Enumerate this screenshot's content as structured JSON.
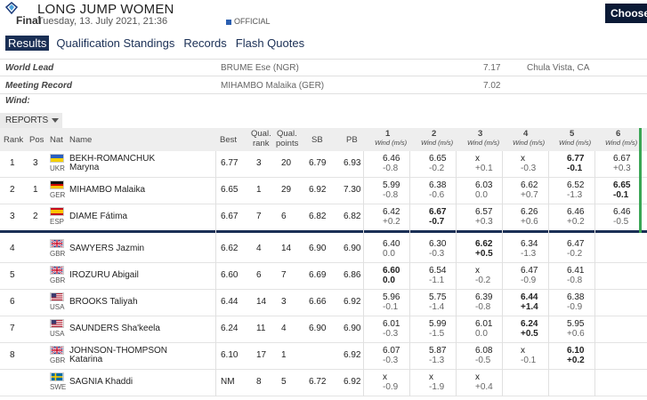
{
  "header": {
    "title": "LONG JUMP WOMEN",
    "phase": "Final",
    "datetime": "Tuesday, 13. July 2021, 21:36",
    "official": "OFFICIAL",
    "choose": "Choose"
  },
  "tabs": [
    "Results",
    "Qualification Standings",
    "Records",
    "Flash Quotes"
  ],
  "info": [
    {
      "label": "World Lead",
      "name": "BRUME Ese (NGR)",
      "value": "7.17",
      "place": "Chula Vista, CA"
    },
    {
      "label": "Meeting Record",
      "name": "MIHAMBO Malaika (GER)",
      "value": "7.02",
      "place": ""
    },
    {
      "label": "Wind:",
      "name": "",
      "value": "",
      "place": ""
    }
  ],
  "reports_label": "REPORTS",
  "columns": {
    "rank": "Rank",
    "pos": "Pos",
    "nat": "Nat",
    "name": "Name",
    "best": "Best",
    "qual_rank_1": "Qual.",
    "qual_rank_2": "rank",
    "qual_points_1": "Qual.",
    "qual_points_2": "points",
    "sb": "SB",
    "pb": "PB",
    "attempts": [
      "1",
      "2",
      "3",
      "4",
      "5",
      "6"
    ],
    "wind_label": "Wind (m/s)"
  },
  "rows": [
    {
      "rank": "1",
      "pos": "3",
      "nat": "UKR",
      "name1": "BEKH-ROMANCHUK",
      "name2": "Maryna",
      "best": "6.77",
      "qr": "3",
      "qp": "20",
      "sb": "6.79",
      "pb": "6.93",
      "att": [
        [
          "6.46",
          "-0.8"
        ],
        [
          "6.65",
          "-0.2"
        ],
        [
          "x",
          "+0.1"
        ],
        [
          "x",
          "-0.3"
        ],
        [
          "6.77",
          "-0.1"
        ],
        [
          "6.67",
          "+0.3"
        ]
      ],
      "bold": [
        4
      ]
    },
    {
      "rank": "2",
      "pos": "1",
      "nat": "GER",
      "name1": "MIHAMBO Malaika",
      "name2": "",
      "best": "6.65",
      "qr": "1",
      "qp": "29",
      "sb": "6.92",
      "pb": "7.30",
      "att": [
        [
          "5.99",
          "-0.8"
        ],
        [
          "6.38",
          "-0.6"
        ],
        [
          "6.03",
          "0.0"
        ],
        [
          "6.62",
          "+0.7"
        ],
        [
          "6.52",
          "-1.3"
        ],
        [
          "6.65",
          "-0.1"
        ]
      ],
      "bold": [
        5
      ]
    },
    {
      "rank": "3",
      "pos": "2",
      "nat": "ESP",
      "name1": "DIAME Fátima",
      "name2": "",
      "best": "6.67",
      "qr": "7",
      "qp": "6",
      "sb": "6.82",
      "pb": "6.82",
      "att": [
        [
          "6.42",
          "+0.2"
        ],
        [
          "6.67",
          "-0.7"
        ],
        [
          "6.57",
          "+0.3"
        ],
        [
          "6.26",
          "+0.6"
        ],
        [
          "6.46",
          "+0.2"
        ],
        [
          "6.46",
          "-0.5"
        ]
      ],
      "bold": [
        1
      ]
    },
    {
      "rank": "4",
      "pos": "",
      "nat": "GBR",
      "name1": "SAWYERS Jazmin",
      "name2": "",
      "best": "6.62",
      "qr": "4",
      "qp": "14",
      "sb": "6.90",
      "pb": "6.90",
      "att": [
        [
          "6.40",
          "0.0"
        ],
        [
          "6.30",
          "-0.3"
        ],
        [
          "6.62",
          "+0.5"
        ],
        [
          "6.34",
          "-1.3"
        ],
        [
          "6.47",
          "-0.2"
        ],
        [
          "",
          ""
        ]
      ],
      "bold": [
        2
      ]
    },
    {
      "rank": "5",
      "pos": "",
      "nat": "GBR",
      "name1": "IROZURU Abigail",
      "name2": "",
      "best": "6.60",
      "qr": "6",
      "qp": "7",
      "sb": "6.69",
      "pb": "6.86",
      "att": [
        [
          "6.60",
          "0.0"
        ],
        [
          "6.54",
          "-1.1"
        ],
        [
          "x",
          "-0.2"
        ],
        [
          "6.47",
          "-0.9"
        ],
        [
          "6.41",
          "-0.8"
        ],
        [
          "",
          ""
        ]
      ],
      "bold": [
        0
      ]
    },
    {
      "rank": "6",
      "pos": "",
      "nat": "USA",
      "name1": "BROOKS Taliyah",
      "name2": "",
      "best": "6.44",
      "qr": "14",
      "qp": "3",
      "sb": "6.66",
      "pb": "6.92",
      "att": [
        [
          "5.96",
          "-0.1"
        ],
        [
          "5.75",
          "-1.4"
        ],
        [
          "6.39",
          "-0.8"
        ],
        [
          "6.44",
          "+1.4"
        ],
        [
          "6.38",
          "-0.9"
        ],
        [
          "",
          ""
        ]
      ],
      "bold": [
        3
      ]
    },
    {
      "rank": "7",
      "pos": "",
      "nat": "USA",
      "name1": "SAUNDERS Sha'keela",
      "name2": "",
      "best": "6.24",
      "qr": "11",
      "qp": "4",
      "sb": "6.90",
      "pb": "6.90",
      "att": [
        [
          "6.01",
          "-0.3"
        ],
        [
          "5.99",
          "-1.5"
        ],
        [
          "6.01",
          "0.0"
        ],
        [
          "6.24",
          "+0.5"
        ],
        [
          "5.95",
          "+0.6"
        ],
        [
          "",
          ""
        ]
      ],
      "bold": [
        3
      ]
    },
    {
      "rank": "8",
      "pos": "",
      "nat": "GBR",
      "name1": "JOHNSON-THOMPSON",
      "name2": "Katarina",
      "best": "6.10",
      "qr": "17",
      "qp": "1",
      "sb": "",
      "pb": "6.92",
      "att": [
        [
          "6.07",
          "-0.3"
        ],
        [
          "5.87",
          "-1.3"
        ],
        [
          "6.08",
          "-0.5"
        ],
        [
          "x",
          "-0.1"
        ],
        [
          "6.10",
          "+0.2"
        ],
        [
          "",
          ""
        ]
      ],
      "bold": [
        4
      ]
    },
    {
      "rank": "",
      "pos": "",
      "nat": "SWE",
      "name1": "SAGNIA Khaddi",
      "name2": "",
      "best": "NM",
      "qr": "8",
      "qp": "5",
      "sb": "6.72",
      "pb": "6.92",
      "att": [
        [
          "x",
          "-0.9"
        ],
        [
          "x",
          "-1.9"
        ],
        [
          "x",
          "+0.4"
        ],
        [
          "",
          ""
        ],
        [
          "",
          ""
        ],
        [
          "",
          ""
        ]
      ],
      "bold": []
    }
  ]
}
